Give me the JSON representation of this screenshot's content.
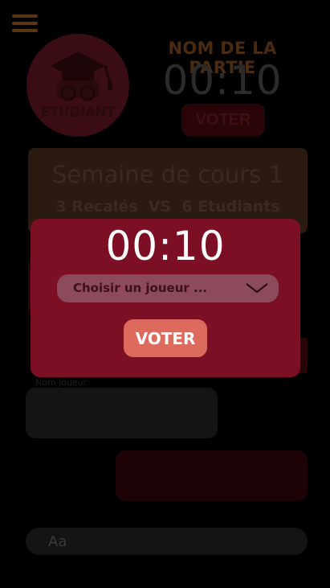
{
  "header": {
    "menu_icon": "hamburger-menu-icon",
    "logo_icon": "graduation-cap-glasses-icon",
    "logo_text": "ETUDIANT",
    "game_name": "NOM DE LA PARTIE",
    "timer": "00:10",
    "vote_label": "VOTER"
  },
  "week_card": {
    "title": "Semaine de cours 1",
    "matchup": "3 Recalés  VS  6 Etudiants"
  },
  "players": {
    "label": "Nom joueur"
  },
  "chat": {
    "placeholder": "Aa"
  },
  "modal": {
    "timer": "00:10",
    "select_placeholder": "Choisir un joueur ...",
    "vote_label": "VOTER"
  },
  "colors": {
    "modal_bg": "#7c0f24",
    "vote_button": "#dc6b5e",
    "select_bg": "#8c4a5a"
  }
}
